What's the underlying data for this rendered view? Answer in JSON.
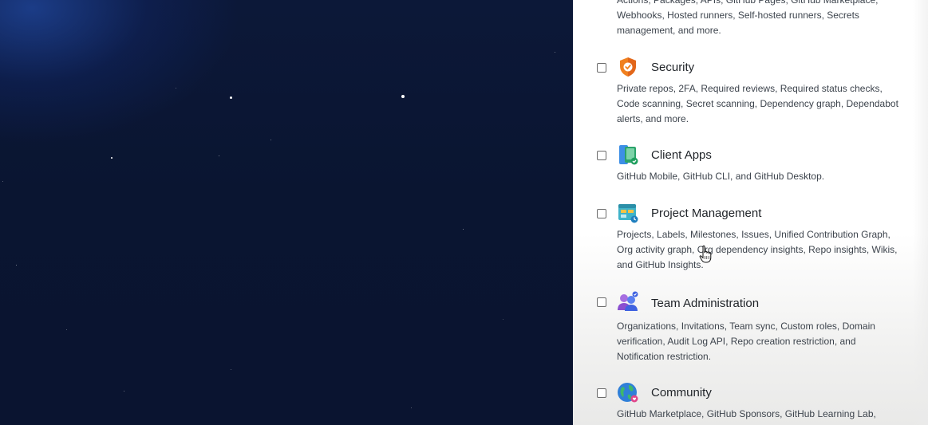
{
  "background": {
    "type": "starfield"
  },
  "features": [
    {
      "id": "actions-partial",
      "title": "",
      "description": "Actions, Packages, APIs, GitHub Pages, GitHub Marketplace, Webhooks, Hosted runners, Self-hosted runners, Secrets management, and more."
    },
    {
      "id": "security",
      "title": "Security",
      "icon": "shield-icon",
      "checked": false,
      "description": "Private repos, 2FA, Required reviews, Required status checks, Code scanning, Secret scanning, Dependency graph, Dependabot alerts, and more."
    },
    {
      "id": "client-apps",
      "title": "Client Apps",
      "icon": "devices-icon",
      "checked": false,
      "description": "GitHub Mobile, GitHub CLI, and GitHub Desktop."
    },
    {
      "id": "project-management",
      "title": "Project Management",
      "icon": "project-board-icon",
      "checked": false,
      "description": "Projects, Labels, Milestones, Issues, Unified Contribution Graph, Org activity graph, Org dependency insights, Repo insights, Wikis, and GitHub Insights."
    },
    {
      "id": "team-administration",
      "title": "Team Administration",
      "icon": "team-icon",
      "checked": false,
      "description": "Organizations, Invitations, Team sync, Custom roles, Domain verification, Audit Log API, Repo creation restriction, and Notification restriction."
    },
    {
      "id": "community",
      "title": "Community",
      "icon": "globe-icon",
      "checked": false,
      "description": "GitHub Marketplace, GitHub Sponsors, GitHub Learning Lab,"
    }
  ],
  "colors": {
    "panel_bg": "#ffffff",
    "space_bg": "#0b1430",
    "title_text": "#1f2328",
    "desc_text": "#3d444d"
  }
}
